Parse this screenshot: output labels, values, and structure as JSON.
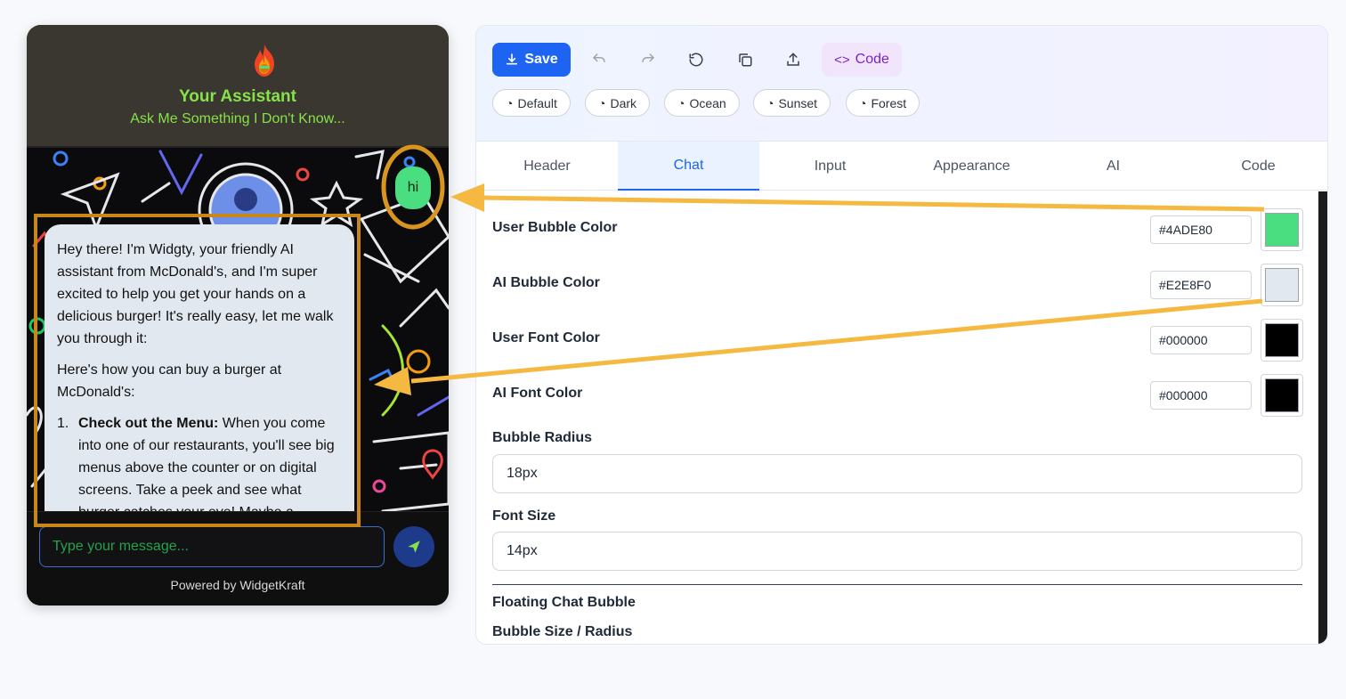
{
  "widget": {
    "title": "Your Assistant",
    "subtitle": "Ask Me Something I Don't Know...",
    "user_message": "hi",
    "ai_message": {
      "p1": "Hey there! I'm Widgty, your friendly AI assistant from McDonald's, and I'm super excited to help you get your hands on a delicious burger! It's really easy, let me walk you through it:",
      "p2": "Here's how you can buy a burger at McDonald's:",
      "list_num": "1.",
      "list_bold": "Check out the Menu:",
      "list_text": " When you come into one of our restaurants, you'll see big menus above the counter or on digital screens. Take a peek and see what burger catches your eye! Maybe a"
    },
    "input_placeholder": "Type your message...",
    "powered_by": "Powered by WidgetKraft",
    "colors": {
      "header_bg": "#3a3630",
      "title": "#86e24a",
      "user_bubble": "#4ADE80",
      "ai_bubble": "#E2E8F0"
    }
  },
  "toolbar": {
    "save_label": "Save",
    "code_label": "Code",
    "icons": [
      "undo-icon",
      "redo-icon",
      "reset-icon",
      "copy-icon",
      "export-icon"
    ],
    "themes": [
      "Default",
      "Dark",
      "Ocean",
      "Sunset",
      "Forest"
    ]
  },
  "tabs": [
    "Header",
    "Chat",
    "Input",
    "Appearance",
    "AI",
    "Code"
  ],
  "active_tab": "Chat",
  "chat_settings": {
    "user_bubble_color": {
      "label": "User Bubble Color",
      "value": "#4ADE80"
    },
    "ai_bubble_color": {
      "label": "AI Bubble Color",
      "value": "#E2E8F0"
    },
    "user_font_color": {
      "label": "User Font Color",
      "value": "#000000"
    },
    "ai_font_color": {
      "label": "AI Font Color",
      "value": "#000000"
    },
    "bubble_radius": {
      "label": "Bubble Radius",
      "value": "18px"
    },
    "font_size": {
      "label": "Font Size",
      "value": "14px"
    },
    "floating_section": "Floating Chat Bubble",
    "bubble_size_label": "Bubble Size / Radius"
  },
  "annotation_color": "#f5b942"
}
